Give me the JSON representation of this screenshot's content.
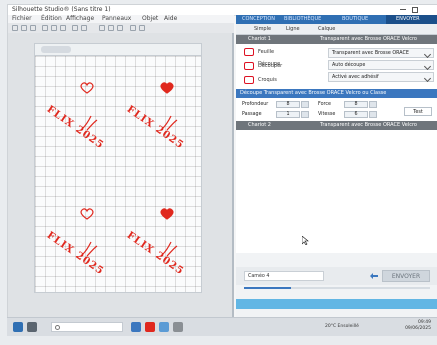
{
  "app": {
    "window_title": "Silhouette Studio® (Sans titre 1)",
    "menu": [
      "Fichier",
      "Édition",
      "Affichage",
      "Panneaux",
      "Objet",
      "Aide"
    ]
  },
  "right_panel": {
    "top_tabs": [
      "CONCEPTION",
      "BIBLIOTHÈQUE",
      "BOUTIQUE",
      "ENVOYER"
    ],
    "active_top_tab": "ENVOYER",
    "sub_tabs": [
      "Simple",
      "Ligne",
      "Calque"
    ],
    "channel1": {
      "label": "Chariot 1",
      "value": "Transparent avec Brosse ORACE Velcro"
    },
    "materials": [
      {
        "label": "Feuille Découpe"
      },
      {
        "label": "Découper"
      },
      {
        "label": "Croquis Contour"
      }
    ],
    "mat_select": "Transparent avec Brosse ORACE",
    "tool_select": "Auto découpe",
    "action_select": "Activé avec adhésif",
    "settings_header": "Découpe Transparent avec Brosse ORACE Velcro ou Classe",
    "fields": {
      "lame_label": "Profondeur",
      "lame_value": "8",
      "passage_label": "Passage",
      "passage_value": "1",
      "force_label": "Force",
      "force_value": "8",
      "vitesse_label": "Vitesse",
      "vitesse_value": "6"
    },
    "tests_button": "Test",
    "channel2": {
      "label": "Chariot 2",
      "value": "Transparent avec Brosse ORACE Velcro"
    },
    "send": {
      "machine_label": "Caméo 4",
      "button": "ENVOYER",
      "progress_percent": 25
    }
  },
  "canvas": {
    "design_text": "FLIX 2025"
  },
  "taskbar": {
    "weather": "20°C Ensoleillé",
    "time": "09:49",
    "date": "09/06/2025"
  },
  "colors": {
    "accent_blue": "#3b77bf",
    "send_tab": "#1b4f8a",
    "design_red": "#e0281e",
    "footer_strip": "#62b6e4"
  }
}
